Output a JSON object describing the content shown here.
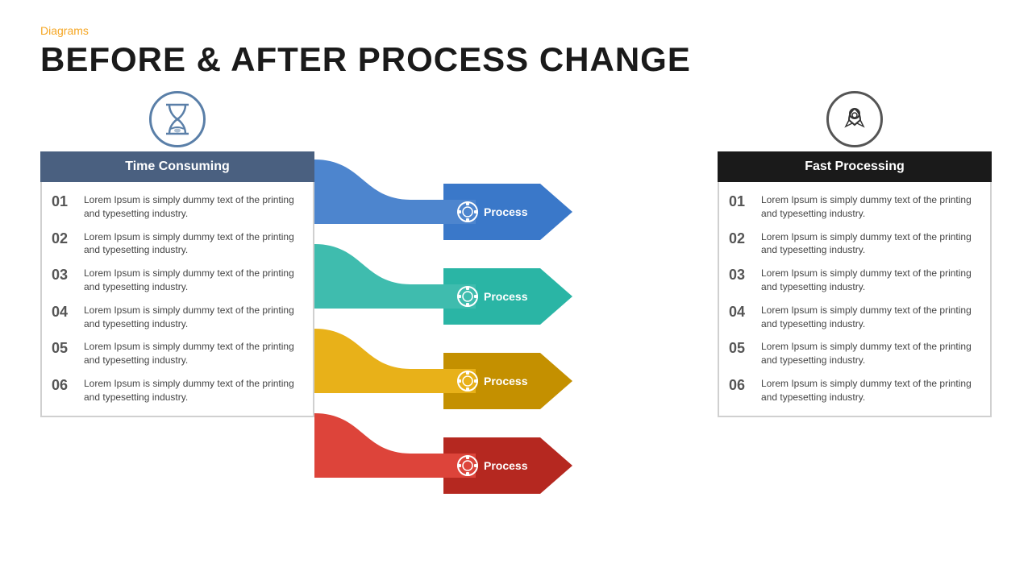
{
  "header": {
    "tag": "Diagrams",
    "title": "BEFORE & AFTER PROCESS CHANGE"
  },
  "left_panel": {
    "header": "Time Consuming",
    "items": [
      {
        "number": "01",
        "text": "Lorem Ipsum is simply dummy text of the printing and typesetting industry."
      },
      {
        "number": "02",
        "text": "Lorem Ipsum is simply dummy text of the printing and typesetting industry."
      },
      {
        "number": "03",
        "text": "Lorem Ipsum is simply dummy text of the printing and typesetting industry."
      },
      {
        "number": "04",
        "text": "Lorem Ipsum is simply dummy text of the printing and typesetting industry."
      },
      {
        "number": "05",
        "text": "Lorem Ipsum is simply dummy text of the printing and typesetting industry."
      },
      {
        "number": "06",
        "text": "Lorem Ipsum is simply dummy text of the printing and typesetting industry."
      }
    ]
  },
  "process_arrows": [
    {
      "label": "Process",
      "color": "#3a78c9"
    },
    {
      "label": "Process",
      "color": "#2ab5a5"
    },
    {
      "label": "Process",
      "color": "#e5a800"
    },
    {
      "label": "Process",
      "color": "#d93025"
    }
  ],
  "right_panel": {
    "header": "Fast Processing",
    "items": [
      {
        "number": "01",
        "text": "Lorem Ipsum is simply dummy text of the printing and typesetting industry."
      },
      {
        "number": "02",
        "text": "Lorem Ipsum is simply dummy text of the printing and typesetting industry."
      },
      {
        "number": "03",
        "text": "Lorem Ipsum is simply dummy text of the printing and typesetting industry."
      },
      {
        "number": "04",
        "text": "Lorem Ipsum is simply dummy text of the printing and typesetting industry."
      },
      {
        "number": "05",
        "text": "Lorem Ipsum is simply dummy text of the printing and typesetting industry."
      },
      {
        "number": "06",
        "text": "Lorem Ipsum is simply dummy text of the printing and typesetting industry."
      }
    ]
  },
  "colors": {
    "tag": "#f5a623",
    "left_header_bg": "#4a6080",
    "right_header_bg": "#1a1a1a",
    "arrow_blue": "#3a78c9",
    "arrow_teal": "#2ab5a5",
    "arrow_yellow": "#e5a800",
    "arrow_red": "#d93025"
  }
}
